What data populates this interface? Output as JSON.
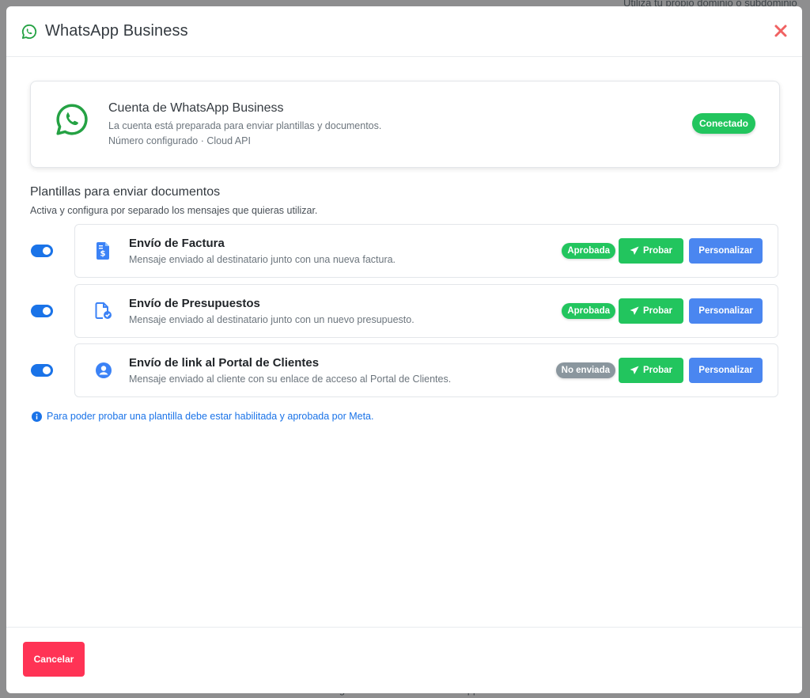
{
  "background": {
    "top_text": "Utiliza tu propio dominio o subdominio",
    "bottom_text": "Ingresa tu número de WhatsApp Business"
  },
  "modal": {
    "title": "WhatsApp Business",
    "close_icon": "close-icon"
  },
  "account": {
    "title": "Cuenta de WhatsApp Business",
    "description": "La cuenta está preparada para enviar plantillas y documentos.",
    "subtitle": "Número configurado · Cloud API",
    "status": "Conectado"
  },
  "templates": {
    "title": "Plantillas para enviar documentos",
    "description": "Activa y configura por separado los mensajes que quieras utilizar.",
    "items": [
      {
        "icon": "invoice-icon",
        "title": "Envío de Factura",
        "description": "Mensaje enviado al destinatario junto con una nueva factura.",
        "status": "Aprobada",
        "enabled": true,
        "test_label": "Probar",
        "customize_label": "Personalizar"
      },
      {
        "icon": "quote-icon",
        "title": "Envío de Presupuestos",
        "description": "Mensaje enviado al destinatario junto con un nuevo presupuesto.",
        "status": "Aprobada",
        "enabled": true,
        "test_label": "Probar",
        "customize_label": "Personalizar"
      },
      {
        "icon": "user-circle-icon",
        "title": "Envío de link al Portal de Clientes",
        "description": "Mensaje enviado al cliente con su enlace de acceso al Portal de Clientes.",
        "status": "No enviada",
        "enabled": true,
        "test_label": "Probar",
        "customize_label": "Personalizar"
      }
    ]
  },
  "info": "Para poder probar una plantilla debe estar habilitada y aprobada por Meta.",
  "footer": {
    "cancel_label": "Cancelar"
  },
  "colors": {
    "whatsapp_green": "#25a244",
    "success": "#22c55e",
    "primary": "#1a73e8",
    "secondary_button": "#4a86f0",
    "danger": "#ff3355",
    "muted_badge": "#8a969e"
  }
}
